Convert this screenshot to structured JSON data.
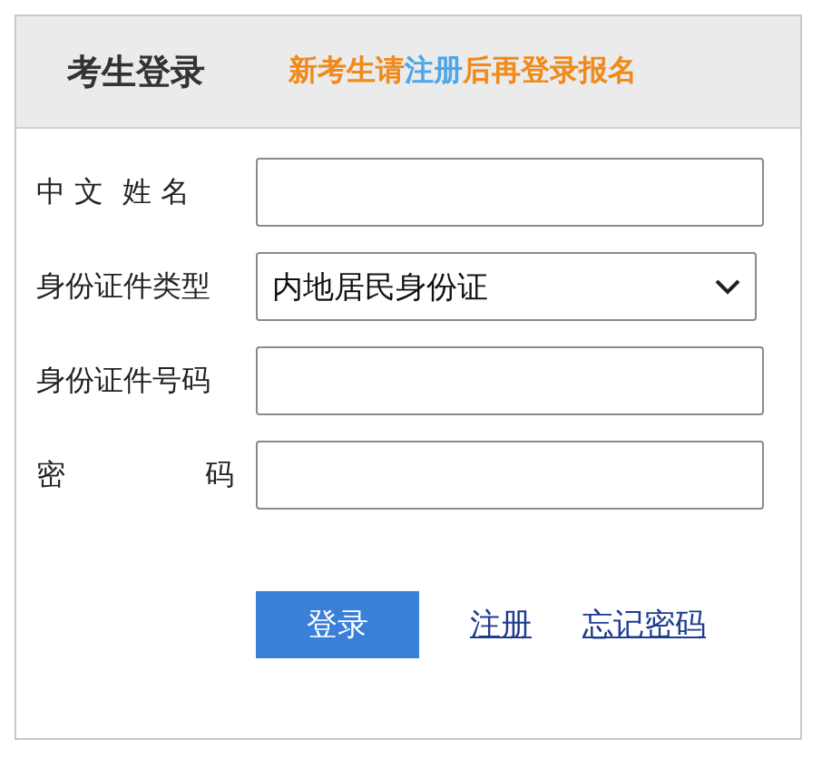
{
  "header": {
    "title": "考生登录",
    "notice": "新考生请**注册**后再登录报名"
  },
  "fields": [
    {
      "kind": "text",
      "label": "中 文  姓 名",
      "justify": false
    },
    {
      "kind": "select",
      "label": "身份证件类型",
      "value": "内地居民身份证",
      "justify": false
    },
    {
      "kind": "text",
      "label": "身份证件号码",
      "justify": false
    },
    {
      "kind": "text",
      "label": "密 码",
      "justify": true
    }
  ],
  "actions": [
    {
      "kind": "button",
      "label": "登录"
    },
    {
      "kind": "link",
      "label": "注册"
    },
    {
      "kind": "link",
      "label": "忘记密码"
    }
  ]
}
